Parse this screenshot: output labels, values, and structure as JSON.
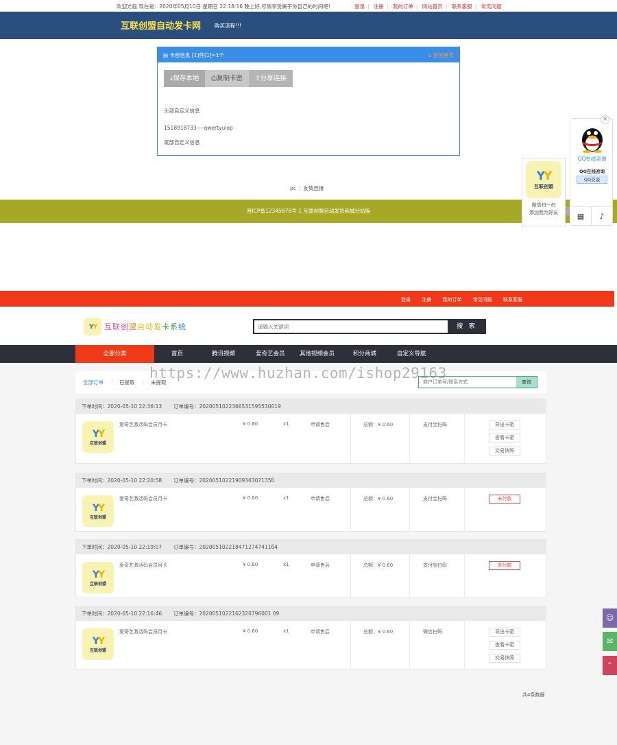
{
  "top": {
    "welcome": "欢迎光临 现在是：2020年05月10日 星期日 22:18:16 晚上好,尽情享受属于你自己的时间吧!",
    "links": [
      "登录",
      "注册",
      "我的订单",
      "网站首页",
      "联系客服",
      "常见问题"
    ]
  },
  "header": {
    "brand": "互联创盟自动发卡网",
    "sub": "购买流程!!!"
  },
  "card_panel": {
    "title": "卡密信息 [1]件[1]=1个",
    "back": "返回首页",
    "buttons": [
      "保存本地",
      "复制卡密",
      "分享连接"
    ],
    "head_msg": "头部自定义信息",
    "card": "1518918733----qwertyuiop",
    "tail_msg": "尾部自定义信息"
  },
  "footer1": {
    "links": [
      "pc",
      "友情连接"
    ],
    "icp": "晋ICP备12345678号-1 互联创盟自动发货商城分站版"
  },
  "qq_widget": {
    "title": "QQ在线咨询",
    "line2": "QQ在线咨询",
    "talk": "QQ交谈",
    "wx_text": [
      "微信扫一扫",
      "添加我为好友"
    ],
    "logo_caption": "互联创盟"
  },
  "section2": {
    "nav": [
      "登录",
      "注册",
      "我的订单",
      "常见问题",
      "联系客服"
    ],
    "logo_text": [
      "互联创",
      "盟",
      "自动发",
      "卡系",
      "统"
    ],
    "logo_caption": "互联创盟",
    "search_placeholder": "请输入关键词",
    "search_btn": "搜 索",
    "menu_all": "全部分类",
    "menu": [
      "首页",
      "腾讯视频",
      "爱奇艺会员",
      "其他视频会员",
      "积分商城",
      "自定义导航"
    ],
    "filter_tabs": [
      "全部订单",
      "已提取",
      "未提取"
    ],
    "query_placeholder": "商户订单号/联系方式",
    "query_btn": "查询",
    "watermark": "https://www.huzhan.com/ishop29163",
    "orders": [
      {
        "time": "下单时间：2020-05-10 22:36:13",
        "no": "订单编号：2020051022366531595530019",
        "name": "爱奇艺激活码会员月卡",
        "price": "¥ 0.60",
        "qty": "x1",
        "after": "申请售后",
        "total": "总额：¥ 0.60",
        "pay": "支付宝扫码",
        "actions": [
          "导出卡密",
          "查看卡密",
          "交易快照"
        ],
        "unpaid": false
      },
      {
        "time": "下单时间：2020-05-10 22:20:58",
        "no": "订单编号：2020051022190936307135б",
        "name": "爱奇艺激活码会员月卡",
        "price": "¥ 0.60",
        "qty": "x1",
        "after": "申请售后",
        "total": "总额：¥ 0.60",
        "pay": "支付宝扫码",
        "actions": [
          "未付款"
        ],
        "unpaid": true
      },
      {
        "time": "下单时间：2020-05-10 22:19:07",
        "no": "订单编号：2020051022184712747411б4",
        "name": "爱奇艺激活码会员月卡",
        "price": "¥ 0.60",
        "qty": "x1",
        "after": "申请售后",
        "total": "总额：¥ 0.60",
        "pay": "支付宝扫码",
        "actions": [
          "未付款"
        ],
        "unpaid": true
      },
      {
        "time": "下单时间：2020-05-10 22:16:46",
        "no": "订单编号：2020051022162320796001 09",
        "name": "爱奇艺激活码会员月卡",
        "price": "¥ 0.60",
        "qty": "x1",
        "after": "申请售后",
        "total": "总额：¥ 0.60",
        "pay": "微信扫码",
        "actions": [
          "导出卡密",
          "查看卡密",
          "交易快照"
        ],
        "unpaid": false
      }
    ],
    "total": "共4条数据"
  },
  "colors": {
    "accent_blue": "#3a8ee6",
    "header_blue": "#2a4f7f",
    "olive": "#a7a826",
    "red": "#f03a17",
    "dark": "#2d2f3a"
  }
}
